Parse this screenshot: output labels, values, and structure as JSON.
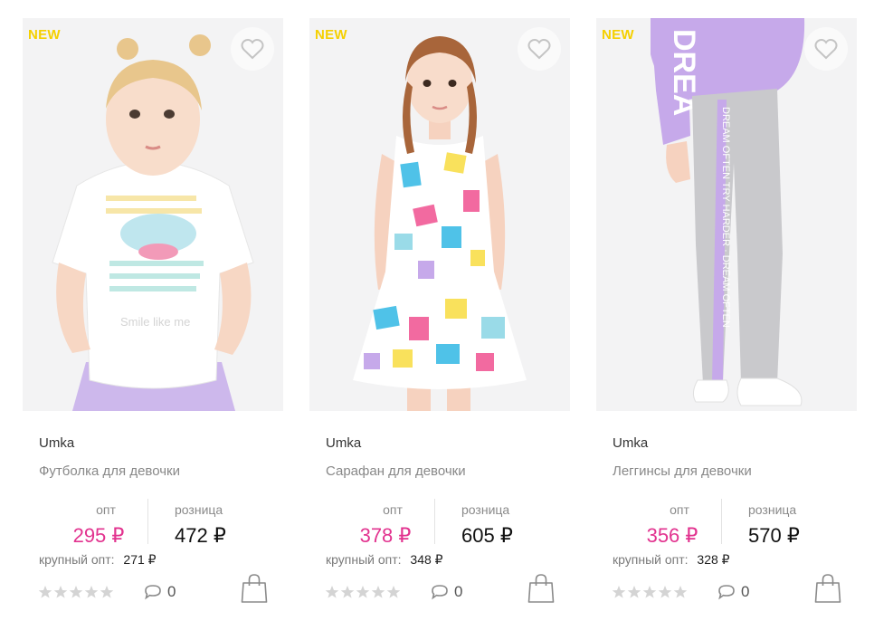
{
  "products": [
    {
      "badge": "NEW",
      "brand": "Umka",
      "name": "Футболка для девочки",
      "opt_label": "опт",
      "opt_price": "295 ₽",
      "retail_label": "розница",
      "retail_price": "472 ₽",
      "bulk_label": "крупный опт:",
      "bulk_price": "271 ₽",
      "rating": 0,
      "comments": "0",
      "image": "toddler-girl-white-tshirt-photo"
    },
    {
      "badge": "NEW",
      "brand": "Umka",
      "name": "Сарафан для девочки",
      "opt_label": "опт",
      "opt_price": "378 ₽",
      "retail_label": "розница",
      "retail_price": "605 ₽",
      "bulk_label": "крупный опт:",
      "bulk_price": "348 ₽",
      "rating": 0,
      "comments": "0",
      "image": "girl-colorful-sundress-photo"
    },
    {
      "badge": "NEW",
      "brand": "Umka",
      "name": "Леггинсы для девочки",
      "opt_label": "опт",
      "opt_price": "356 ₽",
      "retail_label": "розница",
      "retail_price": "570 ₽",
      "bulk_label": "крупный опт:",
      "bulk_price": "328 ₽",
      "rating": 0,
      "comments": "0",
      "image": "grey-leggings-lilac-hoodie-photo"
    }
  ],
  "colors": {
    "badge": "#f5d000",
    "opt_price": "#e2338f",
    "retail_price": "#111111",
    "muted": "#8a8a8a",
    "star_empty": "#d4d4d4"
  },
  "icons": {
    "favorite": "heart-outline-icon",
    "comments": "speech-bubble-icon",
    "cart": "shopping-bag-icon",
    "rating": "star-icon"
  }
}
